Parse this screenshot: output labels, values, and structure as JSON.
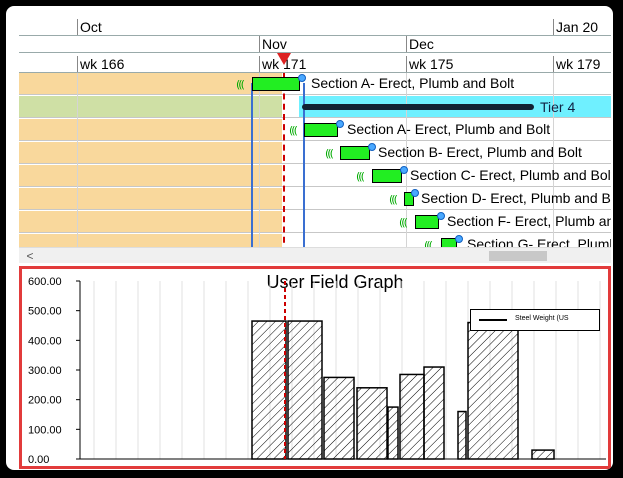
{
  "timeline": {
    "months": [
      {
        "label": "Oct"
      },
      {
        "label": "Nov"
      },
      {
        "label": "Dec"
      },
      {
        "label": "Jan 20"
      }
    ],
    "weeks": [
      {
        "label": "wk 166"
      },
      {
        "label": "wk 171"
      },
      {
        "label": "wk 175"
      },
      {
        "label": "wk 179"
      }
    ]
  },
  "tasks": [
    {
      "label": "Section A- Erect, Plumb and Bolt"
    },
    {
      "label": "Tier 4"
    },
    {
      "label": "Section A- Erect, Plumb and Bolt"
    },
    {
      "label": "Section B- Erect, Plumb and Bolt"
    },
    {
      "label": "Section C- Erect, Plumb and Bolt"
    },
    {
      "label": "Section D- Erect, Plumb and Bolt"
    },
    {
      "label": "Section F- Erect, Plumb and Bolt"
    },
    {
      "label": "Section G- Erect, Plumb and Bolt"
    }
  ],
  "scrollbar": {
    "left_arrow": "<"
  },
  "graph": {
    "title": "User Field Graph",
    "legend": "Steel Weight (US",
    "colors": {
      "border": "#e23b3b",
      "bar_fill": "#ffffff",
      "marker": "#cc0000"
    }
  },
  "chart_data": {
    "type": "bar",
    "title": "User Field Graph",
    "ylim": [
      0,
      600
    ],
    "yticks": [
      "600.00",
      "500.00",
      "400.00",
      "300.00",
      "200.00",
      "100.00",
      "0.00"
    ],
    "legend_placement": "top-right",
    "grid": true,
    "series": [
      {
        "name": "Steel Weight (US",
        "values": [
          465,
          465,
          275,
          240,
          175,
          285,
          310,
          160,
          460,
          30
        ]
      }
    ]
  }
}
